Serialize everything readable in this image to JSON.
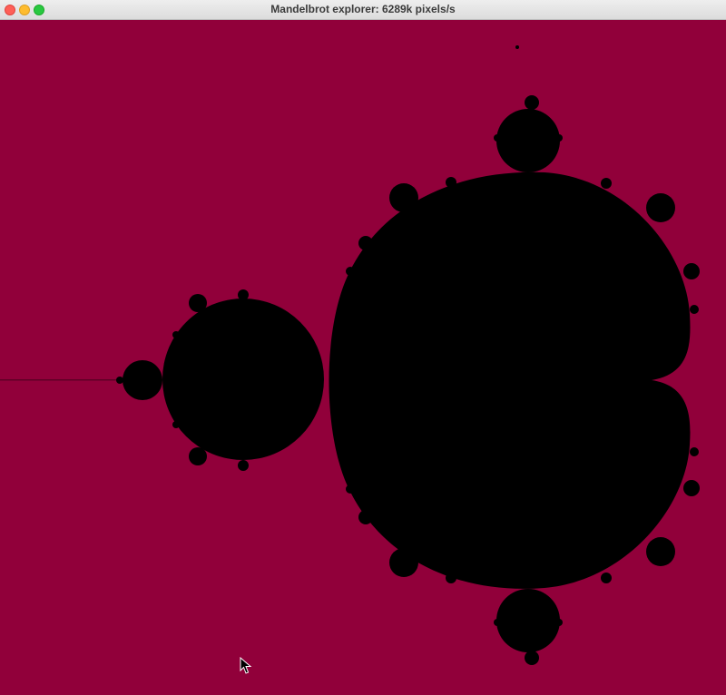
{
  "window": {
    "title": "Mandelbrot explorer: 6289k pixels/s",
    "controls": {
      "close_icon": "close-icon",
      "minimize_icon": "minimize-icon",
      "maximize_icon": "maximize-icon"
    }
  },
  "canvas": {
    "background_color": "#91003a",
    "set_color": "#000000",
    "content": "mandelbrot-set-render"
  },
  "pointer": {
    "icon": "arrow-cursor-icon"
  }
}
